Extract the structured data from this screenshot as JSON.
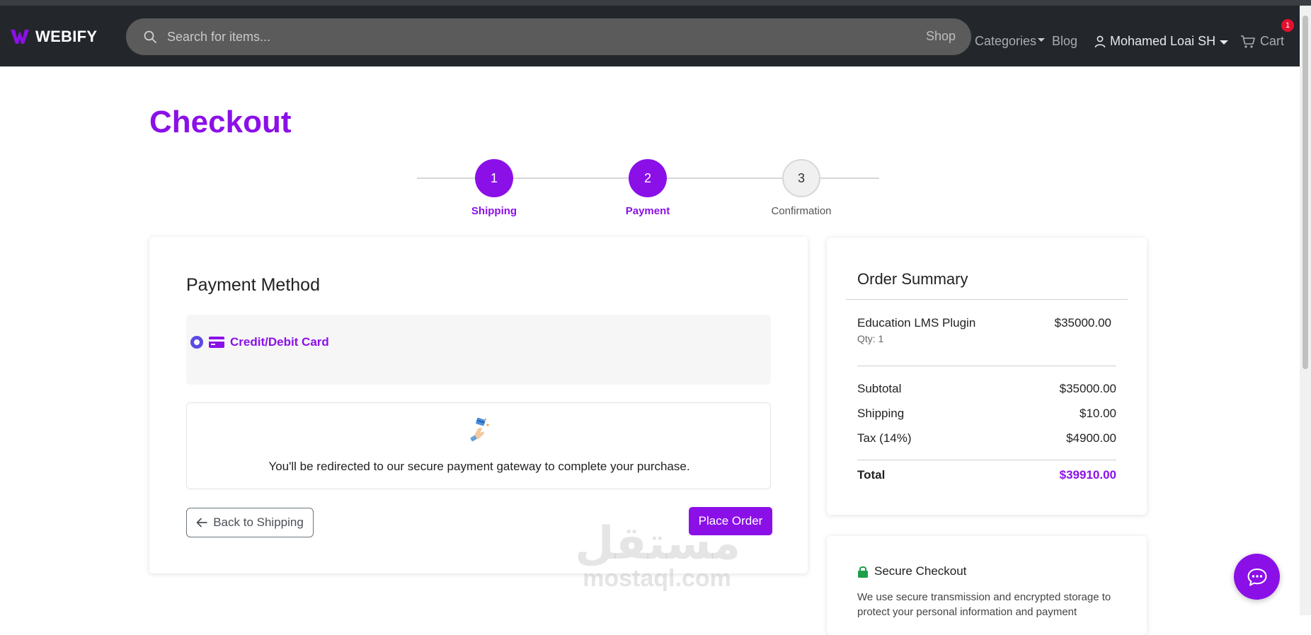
{
  "brand": {
    "name": "WEBIFY",
    "color": "#8b10e8"
  },
  "search": {
    "placeholder": "Search for items...",
    "shop_label": "Shop"
  },
  "nav": {
    "categories_label": "Categories",
    "blog_label": "Blog",
    "user_name": "Mohamed Loai SH",
    "cart_label": "Cart",
    "cart_count": "1"
  },
  "page": {
    "title": "Checkout"
  },
  "steps": [
    {
      "number": "1",
      "label": "Shipping",
      "state": "completed"
    },
    {
      "number": "2",
      "label": "Payment",
      "state": "active"
    },
    {
      "number": "3",
      "label": "Confirmation",
      "state": "pending"
    }
  ],
  "payment": {
    "title": "Payment Method",
    "option_label": "Credit/Debit Card",
    "option_selected": true,
    "info_text": "You'll be redirected to our secure payment gateway to complete your purchase.",
    "back_label": "Back to Shipping",
    "place_order_label": "Place Order"
  },
  "summary": {
    "title": "Order Summary",
    "items": [
      {
        "name": "Education LMS Plugin",
        "qty": "Qty: 1",
        "price": "$35000.00"
      }
    ],
    "subtotal_label": "Subtotal",
    "subtotal_value": "$35000.00",
    "shipping_label": "Shipping",
    "shipping_value": "$10.00",
    "tax_label": "Tax (14%)",
    "tax_value": "$4900.00",
    "total_label": "Total",
    "total_value": "$39910.00"
  },
  "secure": {
    "title": "Secure Checkout",
    "text": "We use secure transmission and encrypted storage to protect your personal information and payment"
  },
  "watermark": {
    "arabic": "مستقل",
    "latin": "mostaql.com"
  },
  "colors": {
    "accent": "#8b10e8",
    "navbar": "#23262b",
    "badge": "#e3102f",
    "lock": "#1e9e4a"
  },
  "icons": {
    "search": "search-icon",
    "user": "user-icon",
    "cart": "cart-icon",
    "card": "credit-card-icon",
    "back": "arrow-left-icon",
    "lock": "lock-icon",
    "chat": "chat-icon"
  }
}
